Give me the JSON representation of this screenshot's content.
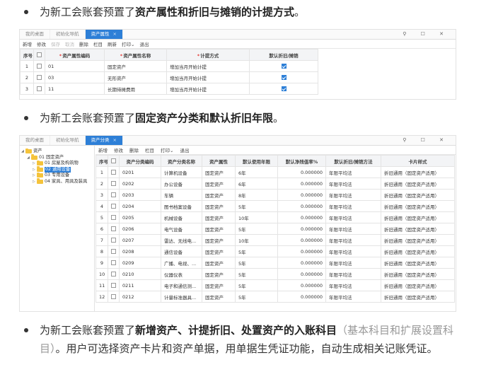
{
  "bullets": {
    "b1": {
      "prefix": "为新工会账套预置了",
      "bold": "资产属性和折旧与摊销的计提方式",
      "suffix": "。"
    },
    "b2": {
      "prefix": "为新工会账套预置了",
      "bold": "固定资产分类和默认折旧年限",
      "suffix": "。"
    },
    "b3": {
      "prefix": "为新工会账套预置了",
      "bold": "新增资产、计提折旧、处置资产的入账科目",
      "muted": "（基本科目和扩展设置科目）",
      "suffix": "。用户可选择资产卡片和资产单据，用单据生凭证功能，自动生成相关记账凭证。"
    }
  },
  "window_controls": "⚲ ☐ ✕",
  "shot1": {
    "tabs": [
      {
        "label": "我的桌面",
        "active": false
      },
      {
        "label": "初始化导航",
        "active": false
      },
      {
        "label": "资产属性",
        "active": true
      }
    ],
    "toolbar": [
      {
        "label": "新增",
        "disabled": false
      },
      {
        "label": "修改",
        "disabled": false
      },
      {
        "label": "保存",
        "disabled": true
      },
      {
        "label": "取消",
        "disabled": true
      },
      {
        "label": "删除",
        "disabled": false
      },
      {
        "label": "栏目",
        "disabled": false
      },
      {
        "label": "刷新",
        "disabled": false
      },
      {
        "label": "打印⌄",
        "disabled": false
      },
      {
        "label": "退出",
        "disabled": false
      }
    ],
    "columns": [
      "序号",
      "",
      "资产属性编码",
      "资产属性名称",
      "计提方式",
      "默认折旧/摊销"
    ],
    "required_cols": [
      2,
      3,
      4
    ],
    "rows": [
      {
        "seq": "1",
        "code": "01",
        "name": "固定资产",
        "method": "增加当月开始计提",
        "default": true
      },
      {
        "seq": "2",
        "code": "03",
        "name": "无形资产",
        "method": "增加当月开始计提",
        "default": true
      },
      {
        "seq": "3",
        "code": "11",
        "name": "长期待摊费用",
        "method": "增加当月开始计提",
        "default": true
      }
    ]
  },
  "shot2": {
    "tabs": [
      {
        "label": "我的桌面",
        "active": false
      },
      {
        "label": "初始化导航",
        "active": false
      },
      {
        "label": "资产分类",
        "active": true
      }
    ],
    "tree": [
      {
        "label": "资产",
        "depth": 0,
        "caret": "◢",
        "selected": false
      },
      {
        "label": "01 固定资产",
        "depth": 1,
        "caret": "◢",
        "selected": false
      },
      {
        "label": "01 房屋及构筑物",
        "depth": 2,
        "caret": "▷",
        "selected": false
      },
      {
        "label": "02 通用设备",
        "depth": 2,
        "caret": "▷",
        "selected": true
      },
      {
        "label": "03 专用设备",
        "depth": 2,
        "caret": "▷",
        "selected": false
      },
      {
        "label": "04 家具、用具及装具",
        "depth": 2,
        "caret": "▷",
        "selected": false
      }
    ],
    "toolbar": [
      "新增",
      "修改",
      "删除",
      "栏目",
      "打印⌄",
      "退出"
    ],
    "columns": [
      "序号",
      "",
      "资产分类编码",
      "资产分类名称",
      "资产属性",
      "默认使用年限",
      "默认净残值率%",
      "默认折旧/摊销方法",
      "卡片样式"
    ],
    "rows": [
      {
        "seq": "1",
        "code": "0201",
        "name": "计算机设备",
        "attr": "固定资产",
        "years": "6年",
        "rate": "0.000000",
        "method": "年限平均法",
        "style": "折旧通用（固定资产适用）"
      },
      {
        "seq": "2",
        "code": "0202",
        "name": "办公设备",
        "attr": "固定资产",
        "years": "6年",
        "rate": "0.000000",
        "method": "年限平均法",
        "style": "折旧通用（固定资产适用）"
      },
      {
        "seq": "3",
        "code": "0203",
        "name": "车辆",
        "attr": "固定资产",
        "years": "8年",
        "rate": "0.000000",
        "method": "年限平均法",
        "style": "折旧通用（固定资产适用）"
      },
      {
        "seq": "4",
        "code": "0204",
        "name": "图书档案设备",
        "attr": "固定资产",
        "years": "5年",
        "rate": "0.000000",
        "method": "年限平均法",
        "style": "折旧通用（固定资产适用）"
      },
      {
        "seq": "5",
        "code": "0205",
        "name": "机械设备",
        "attr": "固定资产",
        "years": "10年",
        "rate": "0.000000",
        "method": "年限平均法",
        "style": "折旧通用（固定资产适用）"
      },
      {
        "seq": "6",
        "code": "0206",
        "name": "电气设备",
        "attr": "固定资产",
        "years": "5年",
        "rate": "0.000000",
        "method": "年限平均法",
        "style": "折旧通用（固定资产适用）"
      },
      {
        "seq": "7",
        "code": "0207",
        "name": "雷达、无线电...",
        "attr": "固定资产",
        "years": "10年",
        "rate": "0.000000",
        "method": "年限平均法",
        "style": "折旧通用（固定资产适用）"
      },
      {
        "seq": "8",
        "code": "0208",
        "name": "通信设备",
        "attr": "固定资产",
        "years": "5年",
        "rate": "0.000000",
        "method": "年限平均法",
        "style": "折旧通用（固定资产适用）"
      },
      {
        "seq": "9",
        "code": "0209",
        "name": "广播、电视、...",
        "attr": "固定资产",
        "years": "5年",
        "rate": "0.000000",
        "method": "年限平均法",
        "style": "折旧通用（固定资产适用）"
      },
      {
        "seq": "10",
        "code": "0210",
        "name": "仪器仪表",
        "attr": "固定资产",
        "years": "5年",
        "rate": "0.000000",
        "method": "年限平均法",
        "style": "折旧通用（固定资产适用）"
      },
      {
        "seq": "11",
        "code": "0211",
        "name": "电子和通信测...",
        "attr": "固定资产",
        "years": "5年",
        "rate": "0.000000",
        "method": "年限平均法",
        "style": "折旧通用（固定资产适用）"
      },
      {
        "seq": "12",
        "code": "0212",
        "name": "计量标准器具...",
        "attr": "固定资产",
        "years": "5年",
        "rate": "0.000000",
        "method": "年限平均法",
        "style": "折旧通用（固定资产适用）"
      }
    ]
  }
}
